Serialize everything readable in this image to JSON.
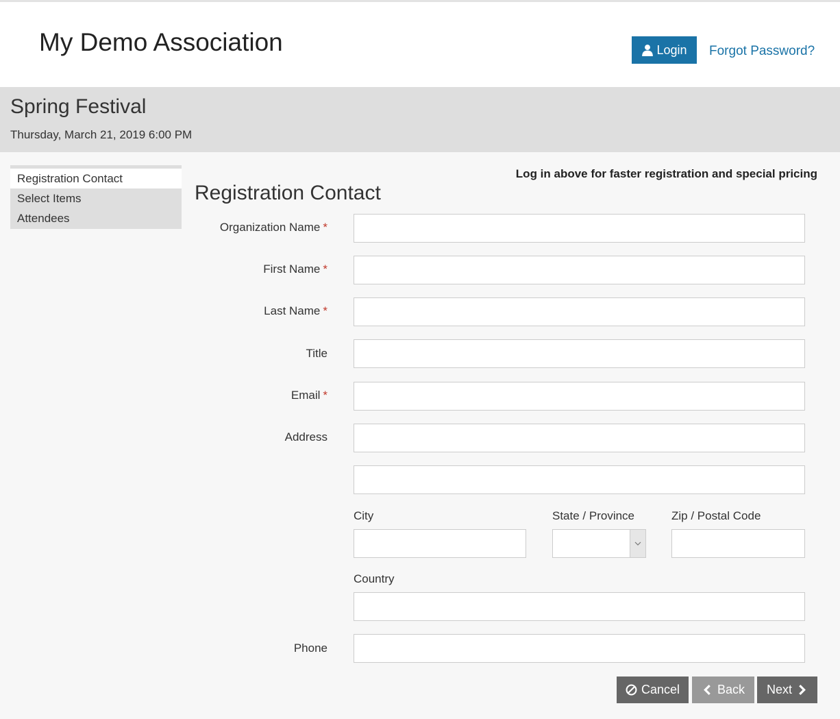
{
  "header": {
    "site_title": "My Demo Association",
    "login_label": "Login",
    "forgot_label": "Forgot Password?"
  },
  "event": {
    "title": "Spring Festival",
    "date": "Thursday, March 21, 2019 6:00 PM"
  },
  "sidenav": {
    "items": [
      {
        "label": "Registration Contact"
      },
      {
        "label": "Select Items"
      },
      {
        "label": "Attendees"
      }
    ]
  },
  "form": {
    "login_hint": "Log in above for faster registration and special pricing",
    "title": "Registration Contact",
    "required_mark": "*",
    "fields": {
      "organization_name": {
        "label": "Organization Name",
        "value": ""
      },
      "first_name": {
        "label": "First Name",
        "value": ""
      },
      "last_name": {
        "label": "Last Name",
        "value": ""
      },
      "title": {
        "label": "Title",
        "value": ""
      },
      "email": {
        "label": "Email",
        "value": ""
      },
      "address": {
        "label": "Address",
        "value": "",
        "value2": ""
      },
      "city": {
        "label": "City",
        "value": ""
      },
      "state": {
        "label": "State / Province",
        "value": ""
      },
      "zip": {
        "label": "Zip / Postal Code",
        "value": ""
      },
      "country": {
        "label": "Country",
        "value": ""
      },
      "phone": {
        "label": "Phone",
        "value": ""
      }
    }
  },
  "actions": {
    "cancel_label": "Cancel",
    "back_label": "Back",
    "next_label": "Next"
  },
  "colors": {
    "accent": "#1a73a7",
    "required": "#c0392b",
    "band": "#dedede",
    "button_dark": "#666666",
    "button_disabled": "#999999"
  }
}
